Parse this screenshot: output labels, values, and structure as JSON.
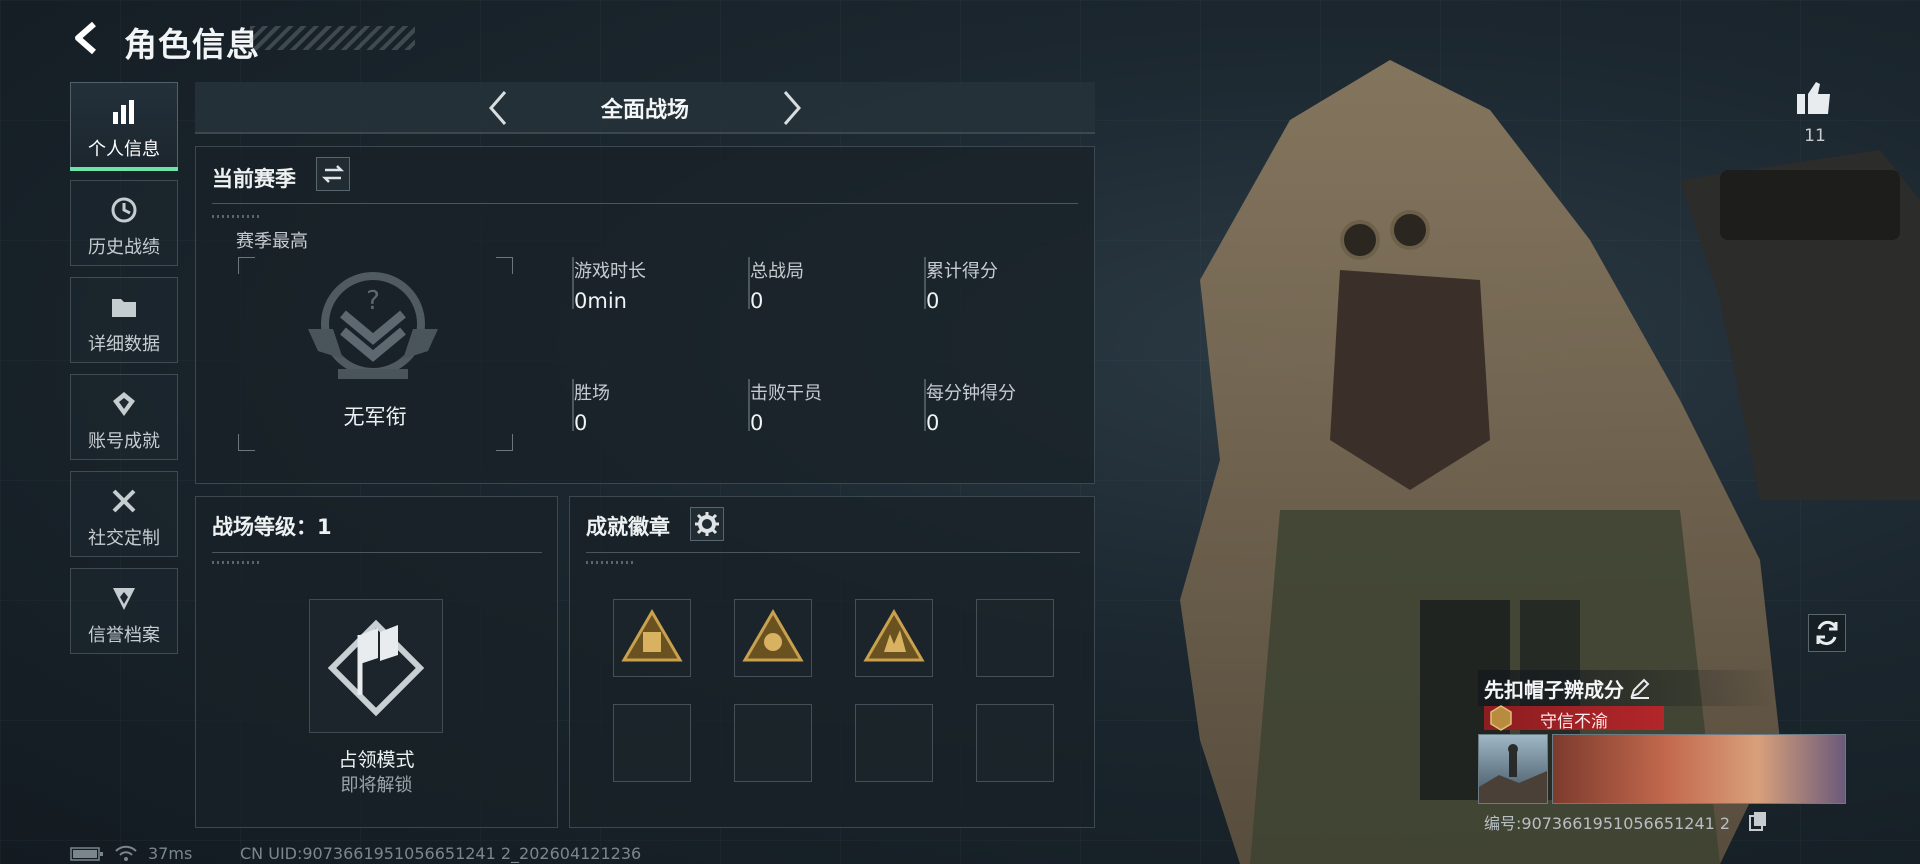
{
  "header": {
    "title": "角色信息",
    "back_icon": "back-arrow-icon"
  },
  "sidebar": {
    "items": [
      {
        "label": "个人信息",
        "icon": "bar-chart-icon",
        "active": true
      },
      {
        "label": "历史战绩",
        "icon": "history-clock-icon",
        "active": false
      },
      {
        "label": "详细数据",
        "icon": "folder-icon",
        "active": false
      },
      {
        "label": "账号成就",
        "icon": "achievement-icon",
        "active": false
      },
      {
        "label": "社交定制",
        "icon": "tools-icon",
        "active": false
      },
      {
        "label": "信誉档案",
        "icon": "shield-icon",
        "active": false
      }
    ]
  },
  "mode_selector": {
    "label": "全面战场"
  },
  "season": {
    "title": "当前赛季",
    "best_label": "赛季最高",
    "rank_name": "无军衔",
    "stats": [
      {
        "label": "游戏时长",
        "value": "0min"
      },
      {
        "label": "总战局",
        "value": "0"
      },
      {
        "label": "累计得分",
        "value": "0"
      },
      {
        "label": "胜场",
        "value": "0"
      },
      {
        "label": "击败干员",
        "value": "0"
      },
      {
        "label": "每分钟得分",
        "value": "0"
      }
    ]
  },
  "battlefield_level": {
    "title": "战场等级：1",
    "mode_name": "占领模式",
    "mode_status": "即将解锁"
  },
  "achievements": {
    "title": "成就徽章",
    "badges": [
      "badge-1",
      "badge-2",
      "badge-3",
      "",
      "",
      "",
      "",
      ""
    ]
  },
  "profile": {
    "likes": "11",
    "name": "先扣帽子辨成分",
    "honor_title": "守信不渝",
    "id_text": "编号:9073661951056651241 2",
    "accent_red": "#b3262a"
  },
  "status_bar": {
    "ping": "37ms",
    "uid": "CN UID:9073661951056651241 2_202604121236"
  }
}
